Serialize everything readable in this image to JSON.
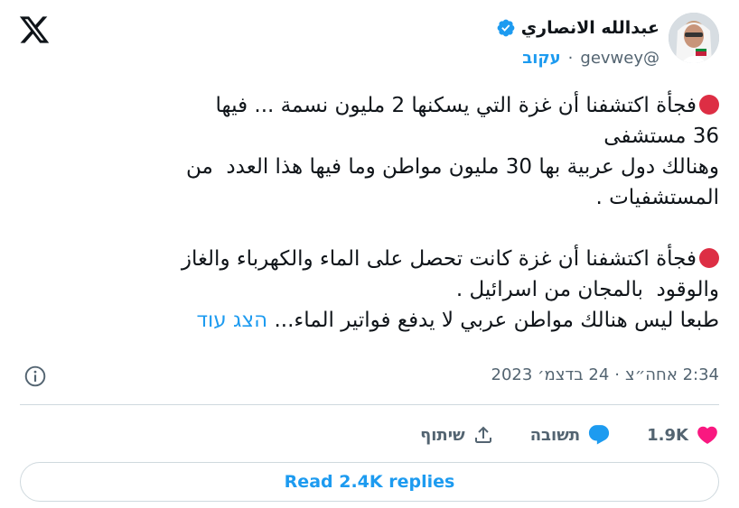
{
  "author": {
    "name": "عبدالله الانصاري",
    "handle": "@gevwey",
    "follow_label": "עקוב",
    "separator": "·"
  },
  "tweet": {
    "p1_line1": "فجأة اكتشفنا أن غزة التي يسكنها 2 مليون نسمة ... فيها",
    "p1_line2": "36 مستشفى",
    "p1_line3": "وهنالك دول عربية بها 30 مليون مواطن وما فيها هذا العدد  من",
    "p1_line4": "المستشفيات .",
    "p2_line1": "فجأة اكتشفنا أن غزة كانت تحصل على الماء والكهرباء والغاز",
    "p2_line2": "والوقود  بالمجان من اسرائيل .",
    "p3_line1": "طبعا ليس هنالك مواطن عربي لا يدفع فواتير الماء...",
    "show_more": "הצג עוד"
  },
  "meta": {
    "time": "2:34 אחה״צ",
    "separator": "·",
    "date": "24 בדצמ׳ 2023"
  },
  "actions": {
    "like_count": "1.9K",
    "reply_label": "תשובה",
    "share_label": "שיתוף"
  },
  "read_replies": "Read 2.4K replies",
  "colors": {
    "accent": "#1d9bf0",
    "like": "#f91880",
    "red_circle": "#dd2e44"
  }
}
